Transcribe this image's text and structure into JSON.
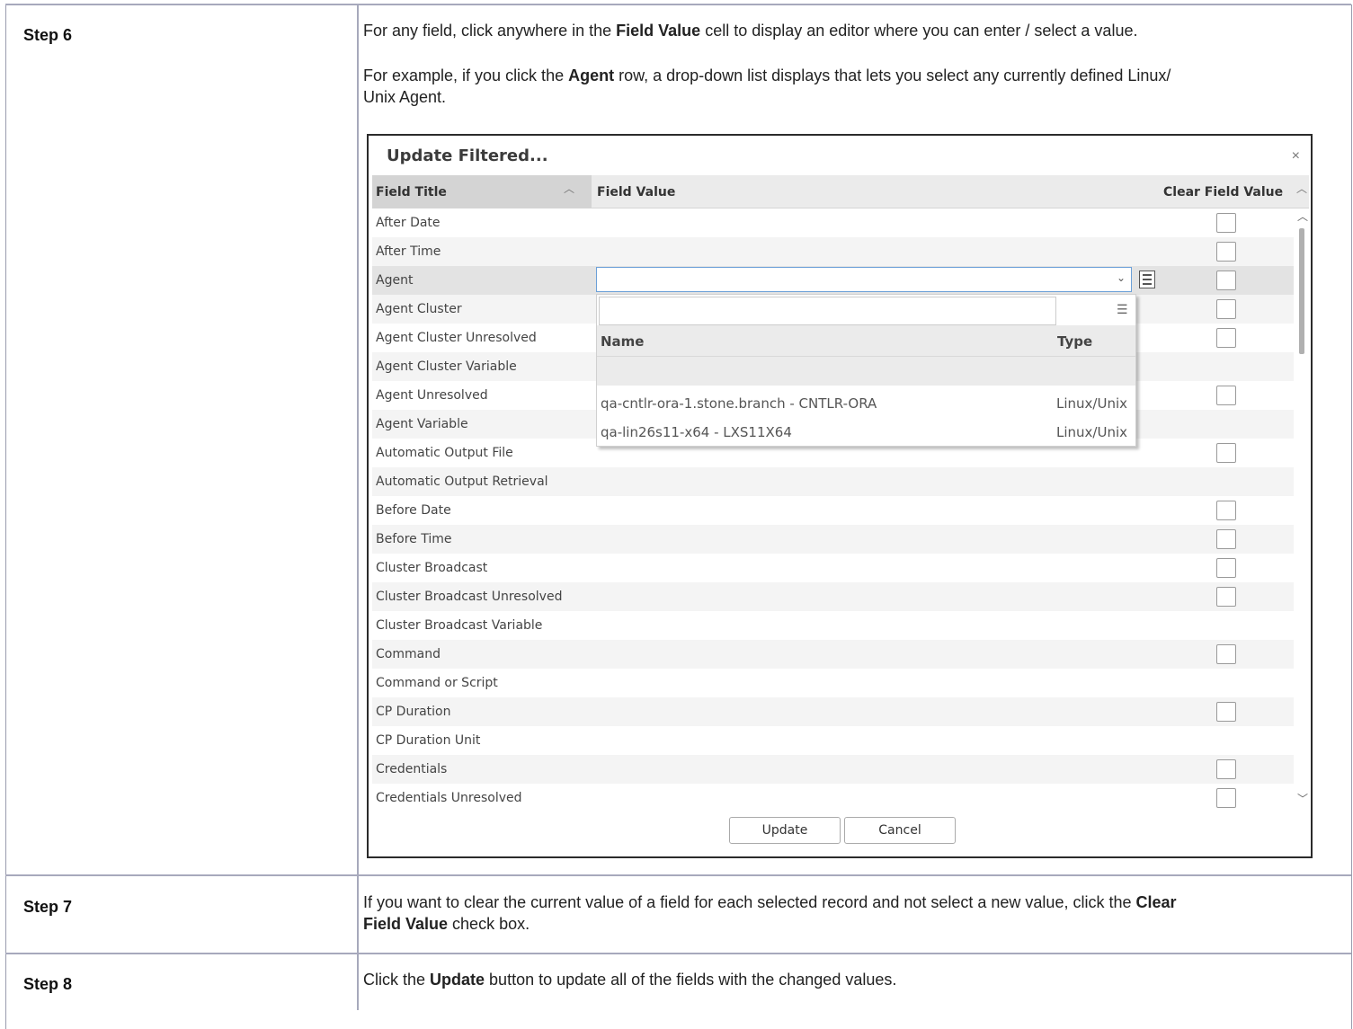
{
  "steps": [
    {
      "label": "Step 6",
      "p1_pre": "For any field, click anywhere in the ",
      "p1_bold": "Field Value",
      "p1_post": " cell to display an editor where you can enter / select a value.",
      "p2_pre": "For example, if you click the ",
      "p2_bold": "Agent",
      "p2_post1": " row, a drop-down list displays that lets you select any currently defined Linux/",
      "p2_post2": "Unix Agent."
    },
    {
      "label": "Step 7",
      "pre": "If you want to clear the current value of a field for each selected record and not select a new value, click the ",
      "bold1": "Clear",
      "bold2": "Field Value",
      "post": " check box."
    },
    {
      "label": "Step 8",
      "pre": "Click the ",
      "bold": "Update",
      "post": " button to update all of the fields with the changed values."
    }
  ],
  "dialog": {
    "title": "Update Filtered...",
    "close": "×",
    "columns": {
      "field_title": "Field Title",
      "field_value": "Field Value",
      "clear": "Clear Field Value"
    },
    "rows": [
      {
        "title": "After Date",
        "checkbox": true
      },
      {
        "title": "After Time",
        "checkbox": true
      },
      {
        "title": "Agent",
        "checkbox": true
      },
      {
        "title": "Agent Cluster",
        "checkbox": true
      },
      {
        "title": "Agent Cluster Unresolved",
        "checkbox": true
      },
      {
        "title": "Agent Cluster Variable",
        "checkbox": false
      },
      {
        "title": "Agent Unresolved",
        "checkbox": true
      },
      {
        "title": "Agent Variable",
        "checkbox": false
      },
      {
        "title": "Automatic Output File",
        "checkbox": true
      },
      {
        "title": "Automatic Output Retrieval",
        "checkbox": false
      },
      {
        "title": "Before Date",
        "checkbox": true
      },
      {
        "title": "Before Time",
        "checkbox": true
      },
      {
        "title": "Cluster Broadcast",
        "checkbox": true
      },
      {
        "title": "Cluster Broadcast Unresolved",
        "checkbox": true
      },
      {
        "title": "Cluster Broadcast Variable",
        "checkbox": false
      },
      {
        "title": "Command",
        "checkbox": true
      },
      {
        "title": "Command or Script",
        "checkbox": false
      },
      {
        "title": "CP Duration",
        "checkbox": true
      },
      {
        "title": "CP Duration Unit",
        "checkbox": false
      },
      {
        "title": "Credentials",
        "checkbox": true
      },
      {
        "title": "Credentials Unresolved",
        "checkbox": true
      }
    ],
    "selected_row": "Agent",
    "combo_value": "",
    "popup": {
      "filter_value": "",
      "columns": {
        "name": "Name",
        "type": "Type"
      },
      "items": [
        {
          "name": "qa-cntlr-ora-1.stone.branch - CNTLR-ORA",
          "type": "Linux/Unix"
        },
        {
          "name": "qa-lin26s11-x64 - LXS11X64",
          "type": "Linux/Unix"
        }
      ]
    },
    "buttons": {
      "update": "Update",
      "cancel": "Cancel"
    },
    "icons": {
      "close": "close-icon",
      "sort": "sort-caret-icon",
      "dropdown": "chevron-down-icon",
      "list": "list-icon",
      "filter": "filter-icon"
    }
  }
}
